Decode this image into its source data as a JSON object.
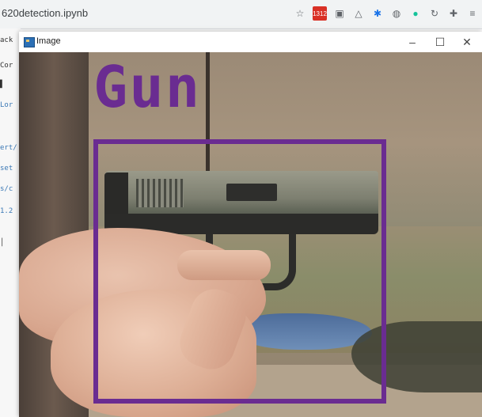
{
  "browser": {
    "tab_title": "620detection.ipynb",
    "badge_count": "1312",
    "icons": [
      "star-icon",
      "extension-badge-icon",
      "photo-icon",
      "drive-icon",
      "extension-icon",
      "globe-icon",
      "grammarly-icon",
      "history-icon",
      "puzzle-icon",
      "menu-icon"
    ]
  },
  "notebook_fragments": [
    "ack",
    "Cor",
    "▌",
    "Lor",
    "ert/",
    "set",
    "s/c",
    "1.2",
    "│"
  ],
  "window": {
    "title": "Image",
    "minimize_glyph": "–",
    "maximize_glyph": "☐",
    "close_glyph": "✕"
  },
  "detection": {
    "label": "Gun",
    "box_color": "#6a2c91"
  }
}
